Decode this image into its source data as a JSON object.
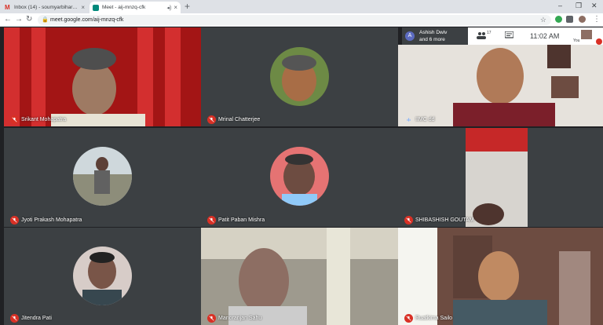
{
  "browser": {
    "tabs": [
      {
        "label": "Inbox (14) - soumyarbiharaimc@",
        "favicon": "gmail-icon",
        "active": false
      },
      {
        "label": "Meet - aij-mnzq-cfk",
        "favicon": "meet-icon",
        "active": true
      }
    ],
    "url": "meet.google.com/aij-mnzq-cfk"
  },
  "meet": {
    "participants_chip": {
      "avatar_letter": "A",
      "line1": "Ashish Dwiv",
      "line2": "and 6 more"
    },
    "people_count": "17",
    "clock": "11:02 AM",
    "self_label": "You",
    "tiles": [
      {
        "name": "Srikant Mohapatra",
        "muted": true
      },
      {
        "name": "Mrinal Chatterjee",
        "muted": true
      },
      {
        "name": "IIMC dd",
        "muted": false
      },
      {
        "name": "Jyoti Prakash Mohapatra",
        "muted": true
      },
      {
        "name": "Patit Paban Mishra",
        "muted": true
      },
      {
        "name": "SHIBASHISH GOUTAM",
        "muted": true
      },
      {
        "name": "Jitendra Pati",
        "muted": true
      },
      {
        "name": "Manoranjan Sahu",
        "muted": true
      },
      {
        "name": "Ruatkima Sailo",
        "muted": true
      }
    ]
  }
}
